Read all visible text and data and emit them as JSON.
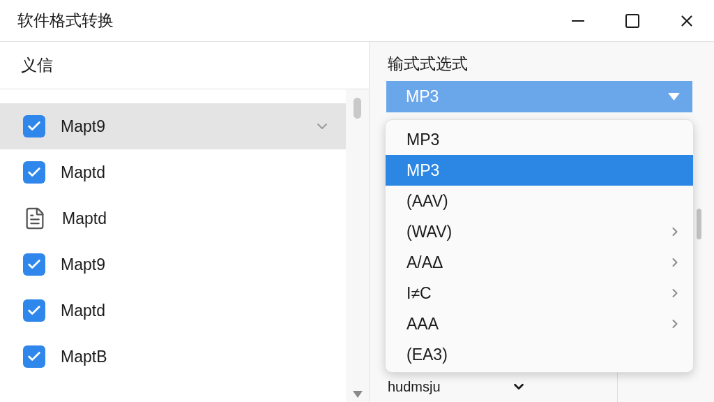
{
  "window": {
    "title": "软件格式转换"
  },
  "title_bar_buttons": [
    {
      "kind": "minimize"
    },
    {
      "kind": "maximize"
    },
    {
      "kind": "close"
    }
  ],
  "file_list": {
    "header": "义信",
    "items": [
      {
        "kind": "checkbox",
        "label": "Mapt9",
        "checked": true,
        "selected": true
      },
      {
        "kind": "checkbox",
        "label": "Maptd",
        "checked": true,
        "selected": false
      },
      {
        "kind": "file",
        "label": "Maptd",
        "selected": false
      },
      {
        "kind": "checkbox",
        "label": "Mapt9",
        "checked": true,
        "selected": false
      },
      {
        "kind": "checkbox",
        "label": "Maptd",
        "checked": true,
        "selected": false
      },
      {
        "kind": "checkbox",
        "label": "MaptB",
        "checked": true,
        "selected": false
      }
    ]
  },
  "format_panel": {
    "label": "输式式选式",
    "dropdown": {
      "value": "MP3",
      "expanded": true
    },
    "menu": [
      {
        "label": "MP3",
        "selected": false,
        "submenu": false
      },
      {
        "label": "MP3",
        "selected": true,
        "submenu": false
      },
      {
        "label": "(AAV)",
        "selected": false,
        "submenu": false
      },
      {
        "label": "(WAV)",
        "selected": false,
        "submenu": true
      },
      {
        "label": "A/AΔ",
        "selected": false,
        "submenu": true
      },
      {
        "label": "I≠C",
        "selected": false,
        "submenu": true
      },
      {
        "label": "AAA",
        "selected": false,
        "submenu": true
      },
      {
        "label": "(EA3)",
        "selected": false,
        "submenu": false
      }
    ],
    "second_select": {
      "value": "hudmsju"
    }
  }
}
